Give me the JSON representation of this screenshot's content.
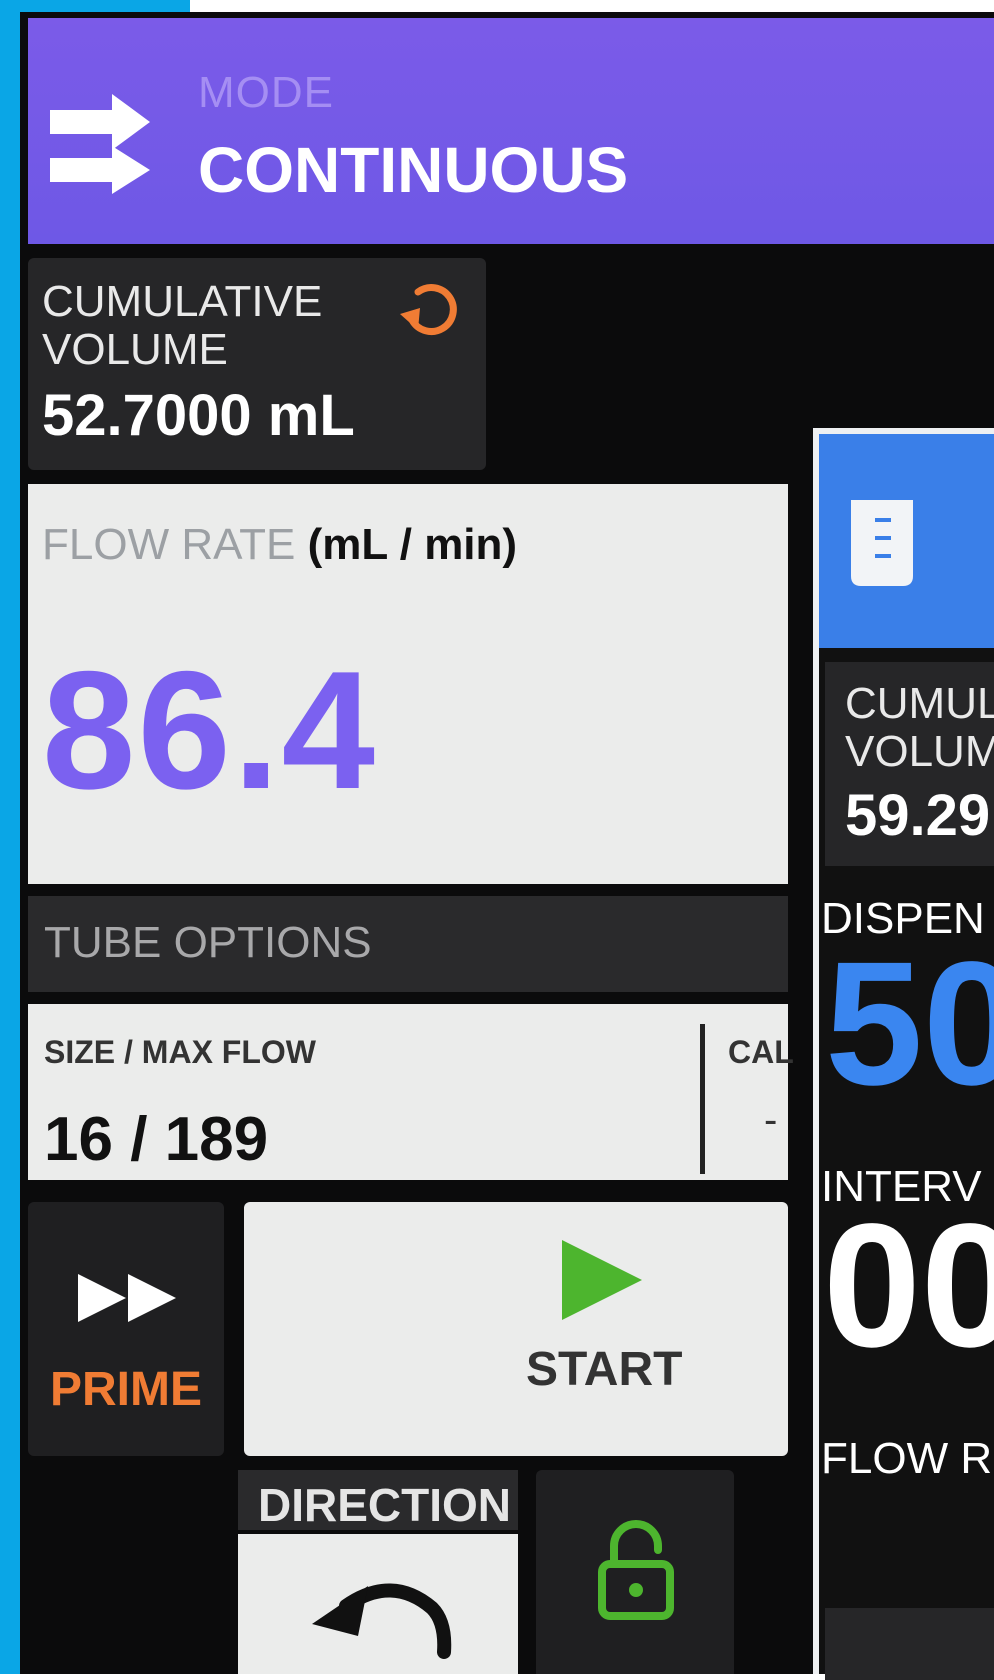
{
  "main_screen": {
    "mode": {
      "label": "MODE",
      "value": "CONTINUOUS",
      "icon": "swap-arrows-icon",
      "color": "#7b5be8"
    },
    "cumulative_volume": {
      "label": "CUMULATIVE VOLUME",
      "value": "52.7000 mL",
      "reset_icon": "reset-icon",
      "reset_color": "#f07c34"
    },
    "flow_rate": {
      "label": "FLOW RATE",
      "unit": "(mL / min)",
      "value": "86.4",
      "color": "#7b61f0"
    },
    "tube_options": {
      "label": "TUBE OPTIONS",
      "size_label": "SIZE / MAX FLOW",
      "size_value": "16 / 189",
      "cal_label": "CAL",
      "cal_value": "-"
    },
    "prime": {
      "label": "PRIME",
      "icon": "fast-forward-icon",
      "color": "#f07c34"
    },
    "start": {
      "label": "START",
      "icon": "play-icon",
      "color": "#4db52e"
    },
    "direction": {
      "label": "DIRECTION",
      "icon": "counterclockwise-arrow-icon"
    },
    "lock": {
      "icon": "unlock-icon",
      "color": "#4db52e"
    }
  },
  "second_screen": {
    "header_icon": "dispense-icon",
    "header_color": "#3a7fe8",
    "cumulative_label": "CUMUL\nVOLUM",
    "cumulative_value": "59.29",
    "dispense_label": "DISPEN",
    "dispense_value": "50",
    "interval_label": "INTERV",
    "interval_value": "00",
    "flow_label": "FLOW R"
  }
}
